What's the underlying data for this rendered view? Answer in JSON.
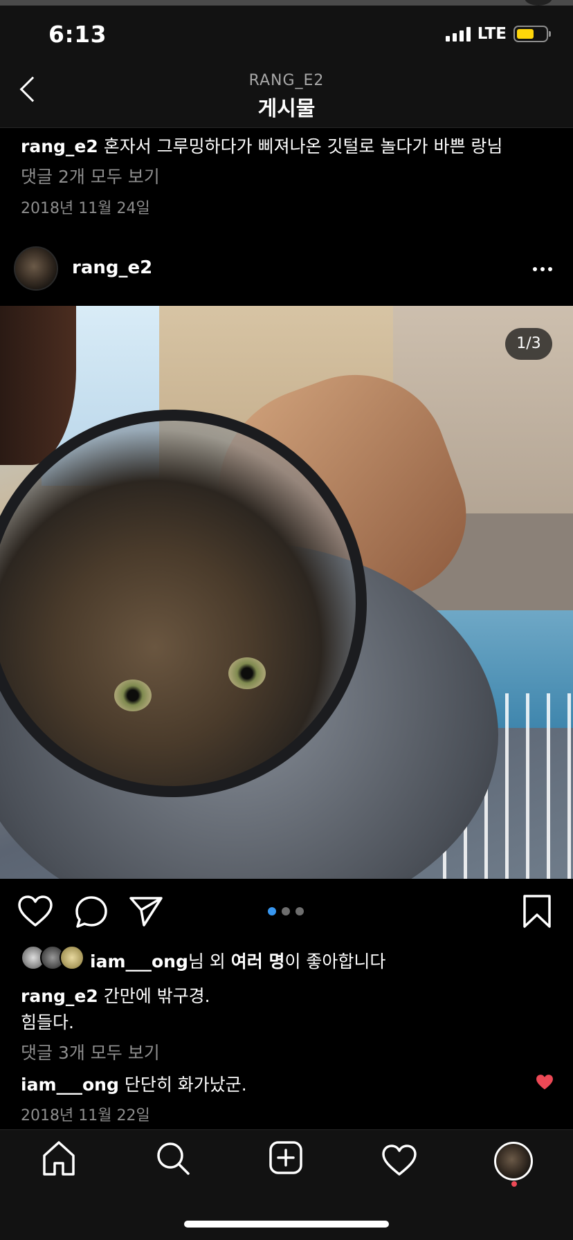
{
  "status_bar": {
    "time": "6:13",
    "network": "LTE"
  },
  "header": {
    "subtitle": "RANG_E2",
    "title": "게시물"
  },
  "prev_post": {
    "username": "rang_e2",
    "caption": "혼자서 그루밍하다가 삐져나온 깃털로 놀다가 바쁜 랑님",
    "view_comments": "댓글 2개 모두 보기",
    "date": "2018년 11월 24일"
  },
  "post": {
    "username": "rang_e2",
    "counter": "1/3",
    "carousel": {
      "count": 3,
      "active": 0
    },
    "likes": {
      "user": "iam___ong",
      "suffix1": "님 외 ",
      "many": "여러 명",
      "suffix2": "이 좋아합니다"
    },
    "caption_user": "rang_e2",
    "caption_line1": "간만에 밖구경.",
    "caption_line2": "힘들다.",
    "view_comments": "댓글 3개 모두 보기",
    "comment": {
      "user": "iam___ong",
      "text": "단단히 화가났군."
    },
    "date": "2018년 11월 22일"
  },
  "colors": {
    "accent": "#3897f0",
    "heart": "#ed4956",
    "battery": "#ffd60a"
  },
  "icons": [
    "back-icon",
    "more-icon",
    "heart-icon",
    "comment-icon",
    "share-icon",
    "bookmark-icon",
    "home-icon",
    "search-icon",
    "add-icon",
    "activity-icon"
  ]
}
